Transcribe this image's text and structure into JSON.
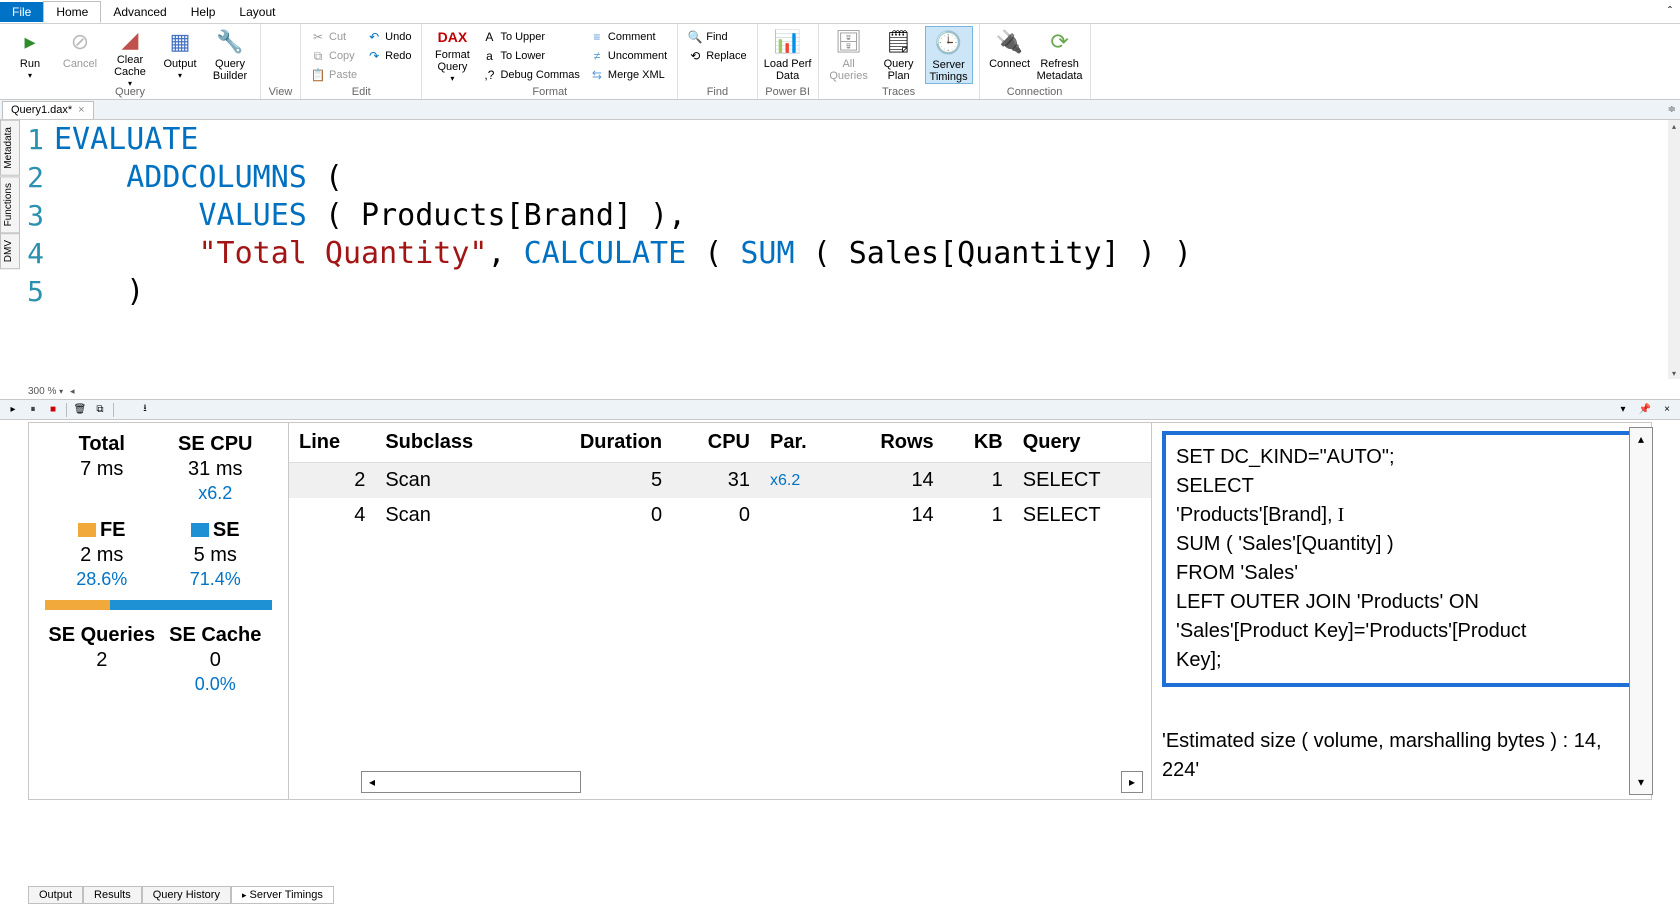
{
  "ribbon": {
    "tabs": [
      "File",
      "Home",
      "Advanced",
      "Help",
      "Layout"
    ],
    "active": "Home",
    "groups": {
      "query": {
        "label": "Query",
        "run": "Run",
        "cancel": "Cancel",
        "clear": "Clear Cache",
        "output": "Output",
        "builder": "Query Builder"
      },
      "view": {
        "label": "View"
      },
      "edit": {
        "label": "Edit",
        "cut": "Cut",
        "copy": "Copy",
        "paste": "Paste",
        "undo": "Undo",
        "redo": "Redo"
      },
      "format": {
        "label": "Format",
        "dax": "DAX",
        "formatq": "Format Query",
        "upper": "To Upper",
        "lower": "To Lower",
        "debug": "Debug Commas",
        "comment": "Comment",
        "uncomment": "Uncomment",
        "merge": "Merge XML"
      },
      "find": {
        "label": "Find",
        "find": "Find",
        "replace": "Replace"
      },
      "powerbi": {
        "label": "Power BI",
        "load": "Load Perf Data"
      },
      "traces": {
        "label": "Traces",
        "all": "All Queries",
        "plan": "Query Plan",
        "timings": "Server Timings"
      },
      "connection": {
        "label": "Connection",
        "connect": "Connect",
        "refresh": "Refresh Metadata"
      }
    }
  },
  "docTab": {
    "name": "Query1.dax*"
  },
  "sideTabs": [
    "Metadata",
    "Functions",
    "DMV"
  ],
  "code": {
    "lines": [
      {
        "n": "1",
        "seg": [
          {
            "t": "EVALUATE",
            "c": "kw"
          }
        ]
      },
      {
        "n": "2",
        "seg": [
          {
            "t": "    ",
            "c": ""
          },
          {
            "t": "ADDCOLUMNS",
            "c": "kw"
          },
          {
            "t": " (",
            "c": ""
          }
        ]
      },
      {
        "n": "3",
        "seg": [
          {
            "t": "        ",
            "c": ""
          },
          {
            "t": "VALUES",
            "c": "kw"
          },
          {
            "t": " ( Products[Brand] ),",
            "c": ""
          }
        ]
      },
      {
        "n": "4",
        "seg": [
          {
            "t": "        ",
            "c": ""
          },
          {
            "t": "\"Total Quantity\"",
            "c": "str"
          },
          {
            "t": ", ",
            "c": ""
          },
          {
            "t": "CALCULATE",
            "c": "fn"
          },
          {
            "t": " ( ",
            "c": ""
          },
          {
            "t": "SUM",
            "c": "fn"
          },
          {
            "t": " ( Sales[Quantity] ) )",
            "c": ""
          }
        ]
      },
      {
        "n": "5",
        "seg": [
          {
            "t": "    )",
            "c": ""
          }
        ]
      }
    ],
    "zoom": "300 %"
  },
  "stats": {
    "total": {
      "label": "Total",
      "val": "7 ms"
    },
    "secpu": {
      "label": "SE CPU",
      "val": "31 ms",
      "mult": "x6.2"
    },
    "fe": {
      "label": "FE",
      "val": "2 ms",
      "pct": "28.6%"
    },
    "se": {
      "label": "SE",
      "val": "5 ms",
      "pct": "71.4%"
    },
    "barFE": 28.6,
    "barSE": 71.4,
    "seq": {
      "label": "SE Queries",
      "val": "2"
    },
    "secache": {
      "label": "SE Cache",
      "val": "0",
      "pct": "0.0%"
    }
  },
  "scan": {
    "headers": [
      "Line",
      "Subclass",
      "Duration",
      "CPU",
      "Par.",
      "Rows",
      "KB",
      "Query"
    ],
    "rows": [
      {
        "line": "2",
        "subclass": "Scan",
        "duration": "5",
        "cpu": "31",
        "par": "x6.2",
        "rows": "14",
        "kb": "1",
        "query": "SELECT"
      },
      {
        "line": "4",
        "subclass": "Scan",
        "duration": "0",
        "cpu": "0",
        "par": "",
        "rows": "14",
        "kb": "1",
        "query": "SELECT"
      }
    ]
  },
  "sql": {
    "lines": [
      "SET DC_KIND=\"AUTO\";",
      "SELECT",
      "'Products'[Brand],",
      "SUM ( 'Sales'[Quantity] )",
      "FROM 'Sales'",
      "        LEFT OUTER JOIN 'Products' ON",
      "'Sales'[Product Key]='Products'[Product",
      "Key];"
    ],
    "estimated": "'Estimated size ( volume, marshalling bytes ) : 14, 224'"
  },
  "bottomTabs": [
    "Output",
    "Results",
    "Query History",
    "Server Timings"
  ],
  "bottomActive": "Server Timings"
}
